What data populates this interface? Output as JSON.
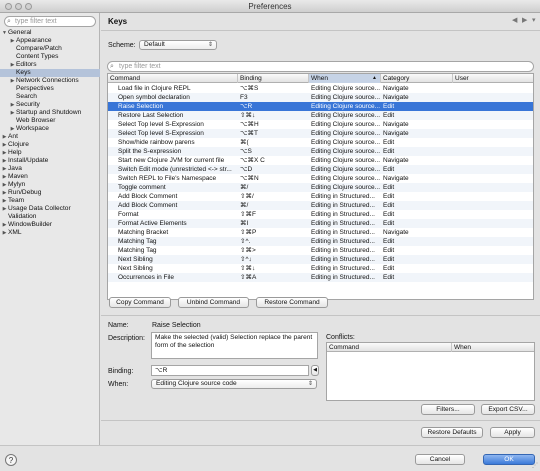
{
  "window": {
    "title": "Preferences"
  },
  "left": {
    "filter_placeholder": "type filter text",
    "tree": [
      {
        "label": "General",
        "level": 0,
        "toggle": "▼"
      },
      {
        "label": "Appearance",
        "level": 1,
        "toggle": "▶"
      },
      {
        "label": "Compare/Patch",
        "level": 1,
        "toggle": ""
      },
      {
        "label": "Content Types",
        "level": 1,
        "toggle": ""
      },
      {
        "label": "Editors",
        "level": 1,
        "toggle": "▶"
      },
      {
        "label": "Keys",
        "level": 1,
        "toggle": "",
        "selected": true
      },
      {
        "label": "Network Connections",
        "level": 1,
        "toggle": "▶"
      },
      {
        "label": "Perspectives",
        "level": 1,
        "toggle": ""
      },
      {
        "label": "Search",
        "level": 1,
        "toggle": ""
      },
      {
        "label": "Security",
        "level": 1,
        "toggle": "▶"
      },
      {
        "label": "Startup and Shutdown",
        "level": 1,
        "toggle": "▶"
      },
      {
        "label": "Web Browser",
        "level": 1,
        "toggle": ""
      },
      {
        "label": "Workspace",
        "level": 1,
        "toggle": "▶"
      },
      {
        "label": "Ant",
        "level": 0,
        "toggle": "▶"
      },
      {
        "label": "Clojure",
        "level": 0,
        "toggle": "▶"
      },
      {
        "label": "Help",
        "level": 0,
        "toggle": "▶"
      },
      {
        "label": "Install/Update",
        "level": 0,
        "toggle": "▶"
      },
      {
        "label": "Java",
        "level": 0,
        "toggle": "▶"
      },
      {
        "label": "Maven",
        "level": 0,
        "toggle": "▶"
      },
      {
        "label": "Mylyn",
        "level": 0,
        "toggle": "▶"
      },
      {
        "label": "Run/Debug",
        "level": 0,
        "toggle": "▶"
      },
      {
        "label": "Team",
        "level": 0,
        "toggle": "▶"
      },
      {
        "label": "Usage Data Collector",
        "level": 0,
        "toggle": "▶"
      },
      {
        "label": "Validation",
        "level": 0,
        "toggle": ""
      },
      {
        "label": "WindowBuilder",
        "level": 0,
        "toggle": "▶"
      },
      {
        "label": "XML",
        "level": 0,
        "toggle": "▶"
      }
    ]
  },
  "header": {
    "title": "Keys",
    "back_icon": "back-arrow-icon",
    "forward_icon": "forward-arrow-icon",
    "menu_icon": "menu-chevron-icon"
  },
  "scheme": {
    "label": "Scheme:",
    "value": "Default"
  },
  "search": {
    "placeholder": "type filter text"
  },
  "table": {
    "columns": [
      "Command",
      "Binding",
      "When",
      "Category",
      "User"
    ],
    "rows": [
      {
        "command": "Load file in Clojure REPL",
        "binding": "⌥⌘S",
        "when": "Editing Clojure source...",
        "category": "Navigate",
        "user": ""
      },
      {
        "command": "Open symbol declaration",
        "binding": "F3",
        "when": "Editing Clojure source...",
        "category": "Navigate",
        "user": ""
      },
      {
        "command": "Raise Selection",
        "binding": "⌥R",
        "when": "Editing Clojure source...",
        "category": "Edit",
        "user": "",
        "selected": true
      },
      {
        "command": "Restore Last Selection",
        "binding": "⇧⌘↓",
        "when": "Editing Clojure source...",
        "category": "Edit",
        "user": ""
      },
      {
        "command": "Select Top level S-Expression",
        "binding": "⌥⌘H",
        "when": "Editing Clojure source...",
        "category": "Navigate",
        "user": ""
      },
      {
        "command": "Select Top level S-Expression",
        "binding": "⌥⌘T",
        "when": "Editing Clojure source...",
        "category": "Navigate",
        "user": ""
      },
      {
        "command": "Show/hide rainbow parens",
        "binding": "⌘(",
        "when": "Editing Clojure source...",
        "category": "Edit",
        "user": ""
      },
      {
        "command": "Split the S-expression",
        "binding": "⌥S",
        "when": "Editing Clojure source...",
        "category": "Edit",
        "user": ""
      },
      {
        "command": "Start new Clojure JVM for current file",
        "binding": "⌥⌘X C",
        "when": "Editing Clojure source...",
        "category": "Navigate",
        "user": ""
      },
      {
        "command": "Switch Edit mode (unrestricted <-> str...",
        "binding": "⌥D",
        "when": "Editing Clojure source...",
        "category": "Edit",
        "user": ""
      },
      {
        "command": "Switch REPL to File's Namespace",
        "binding": "⌥⌘N",
        "when": "Editing Clojure source...",
        "category": "Navigate",
        "user": ""
      },
      {
        "command": "Toggle comment",
        "binding": "⌘/",
        "when": "Editing Clojure source...",
        "category": "Edit",
        "user": ""
      },
      {
        "command": "Add Block Comment",
        "binding": "⇧⌘/",
        "when": "Editing in Structured...",
        "category": "Edit",
        "user": ""
      },
      {
        "command": "Add Block Comment",
        "binding": "⌘/",
        "when": "Editing in Structured...",
        "category": "Edit",
        "user": ""
      },
      {
        "command": "Format",
        "binding": "⇧⌘F",
        "when": "Editing in Structured...",
        "category": "Edit",
        "user": ""
      },
      {
        "command": "Format Active Elements",
        "binding": "⌘I",
        "when": "Editing in Structured...",
        "category": "Edit",
        "user": ""
      },
      {
        "command": "Matching Bracket",
        "binding": "⇧⌘P",
        "when": "Editing in Structured...",
        "category": "Navigate",
        "user": ""
      },
      {
        "command": "Matching Tag",
        "binding": "⇧^.",
        "when": "Editing in Structured...",
        "category": "Edit",
        "user": ""
      },
      {
        "command": "Matching Tag",
        "binding": "⇧⌘>",
        "when": "Editing in Structured...",
        "category": "Edit",
        "user": ""
      },
      {
        "command": "Next Sibling",
        "binding": "⇧^↓",
        "when": "Editing in Structured...",
        "category": "Edit",
        "user": ""
      },
      {
        "command": "Next Sibling",
        "binding": "⇧⌘↓",
        "when": "Editing in Structured...",
        "category": "Edit",
        "user": ""
      },
      {
        "command": "Occurrences in File",
        "binding": "⇧⌘A",
        "when": "Editing in Structured...",
        "category": "Edit",
        "user": ""
      }
    ]
  },
  "buttons": {
    "copy": "Copy Command",
    "unbind": "Unbind Command",
    "restore": "Restore Command",
    "filters": "Filters...",
    "export": "Export CSV...",
    "restore_defaults": "Restore Defaults",
    "apply": "Apply",
    "cancel": "Cancel",
    "ok": "OK"
  },
  "details": {
    "name_label": "Name:",
    "name_value": "Raise Selection",
    "description_label": "Description:",
    "description_value": "Make the selected (valid) Selection replace the parent form of the selection",
    "binding_label": "Binding:",
    "binding_value": "⌥R",
    "when_label": "When:",
    "when_value": "Editing Clojure source code",
    "conflicts_label": "Conflicts:",
    "conflicts_columns": [
      "Command",
      "When"
    ]
  },
  "help_icon": "help-icon",
  "colors": {
    "selection": "#3875d7",
    "tree_selected": "#b4c3da",
    "primary_button": "#3b7ad9"
  }
}
